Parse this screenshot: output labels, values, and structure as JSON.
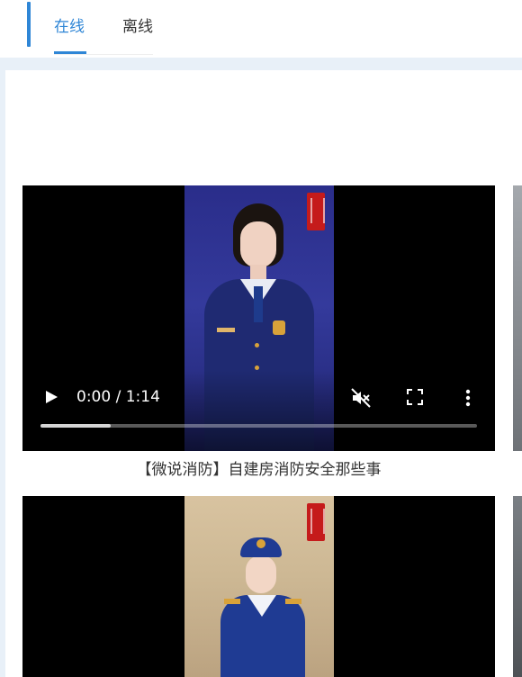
{
  "tabs": [
    {
      "label": "在线",
      "active": true
    },
    {
      "label": "离线",
      "active": false
    }
  ],
  "colors": {
    "accent": "#2f86d6",
    "page_bg": "#e8f0f8"
  },
  "videos": [
    {
      "title": "【微说消防】自建房消防安全那些事",
      "time": "0:00 / 1:14",
      "played_fraction": 0.16,
      "icons": [
        "play-icon",
        "mute-icon",
        "fullscreen-icon",
        "more-options-icon"
      ]
    },
    {
      "title": "",
      "time": ""
    }
  ]
}
